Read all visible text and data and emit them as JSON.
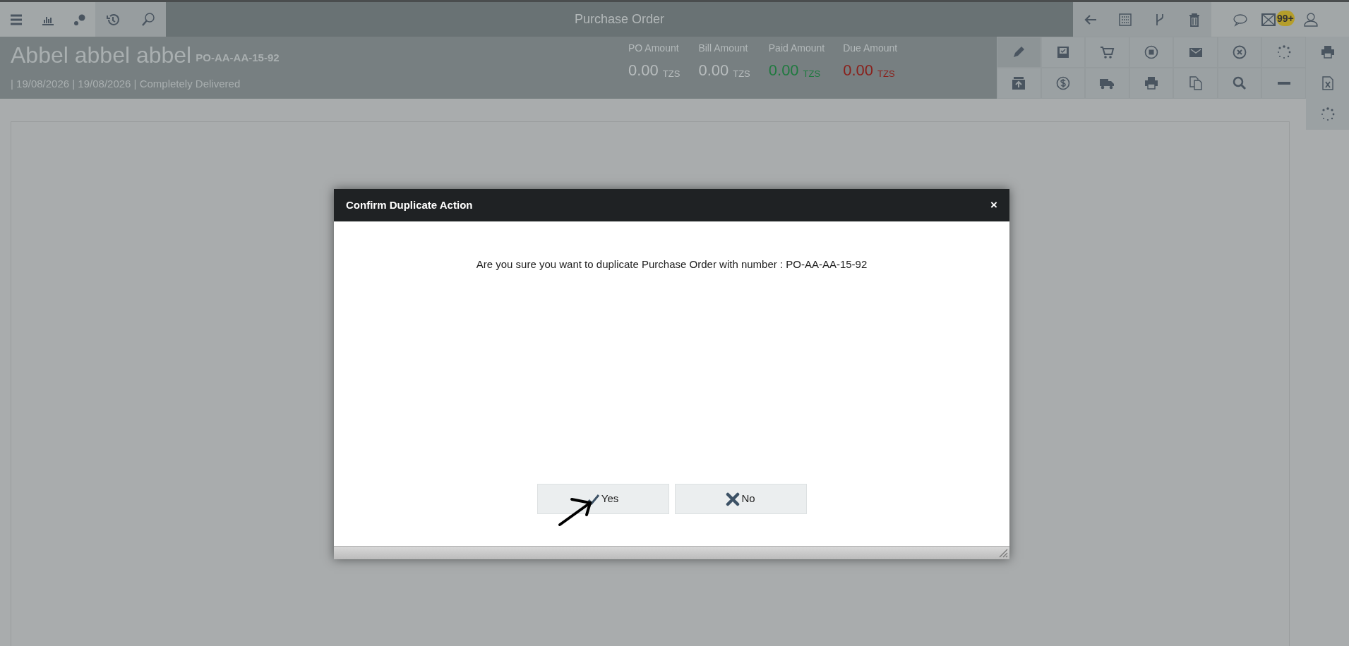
{
  "top_bar": {
    "title": "Purchase Order",
    "notification_badge": "99+"
  },
  "header": {
    "name": "Abbel abbel abbel",
    "number": "PO-AA-AA-15-92",
    "subtitle": "| 19/08/2026 | 19/08/2026 | Completely Delivered",
    "amounts": [
      {
        "label": "PO Amount",
        "value": "0.00",
        "currency": "TZS",
        "kind": "neutral"
      },
      {
        "label": "Bill Amount",
        "value": "0.00",
        "currency": "TZS",
        "kind": "neutral"
      },
      {
        "label": "Paid Amount",
        "value": "0.00",
        "currency": "TZS",
        "kind": "paid"
      },
      {
        "label": "Due Amount",
        "value": "0.00",
        "currency": "TZS",
        "kind": "due"
      }
    ]
  },
  "actions": [
    {
      "selected": true
    },
    {
      "selected": false
    },
    {
      "selected": false
    },
    {
      "selected": false
    },
    {
      "selected": false
    },
    {
      "selected": false
    },
    {
      "selected": false
    },
    {
      "selected": false
    },
    {
      "selected": false
    },
    {
      "selected": false
    },
    {
      "selected": false
    },
    {
      "selected": false
    },
    {
      "selected": false
    },
    {
      "selected": false
    }
  ],
  "dialog": {
    "title": "Confirm Duplicate Action",
    "close": "×",
    "message": "Are you sure you want to duplicate Purchase Order with number : PO-AA-AA-15-92",
    "buttons": [
      {
        "label": "Yes",
        "kind": "yes"
      },
      {
        "label": "No",
        "kind": "no"
      }
    ]
  }
}
